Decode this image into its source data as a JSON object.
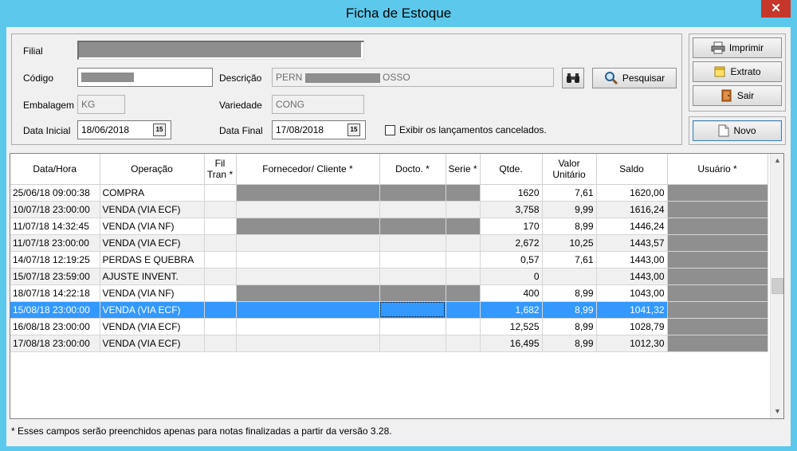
{
  "window": {
    "title": "Ficha de Estoque",
    "close_label": "✕"
  },
  "filters": {
    "filial_label": "Filial",
    "codigo_label": "Código",
    "descricao_label": "Descrição",
    "descricao_prefix": "PERN",
    "descricao_suffix": "OSSO",
    "embalagem_label": "Embalagem",
    "embalagem_value": "KG",
    "variedade_label": "Variedade",
    "variedade_value": "CONG",
    "data_inicial_label": "Data Inicial",
    "data_inicial_value": "18/06/2018",
    "data_final_label": "Data Final",
    "data_final_value": "17/08/2018",
    "cancelados_label": "Exibir os lançamentos cancelados."
  },
  "buttons": {
    "pesquisar": "Pesquisar",
    "imprimir": "Imprimir",
    "extrato": "Extrato",
    "sair": "Sair",
    "novo": "Novo"
  },
  "grid": {
    "columns": [
      "Data/Hora",
      "Operação",
      "Fil Tran *",
      "Fornecedor/ Cliente *",
      "Docto. *",
      "Serie *",
      "Qtde.",
      "Valor Unitário",
      "Saldo",
      "Usuário *"
    ],
    "rows": [
      {
        "data": "25/06/18 09:00:38",
        "op": "COMPRA",
        "qtde": "1620",
        "valor": "7,61",
        "saldo": "1620,00",
        "fc_blur": true
      },
      {
        "data": "10/07/18 23:00:00",
        "op": "VENDA (VIA ECF)",
        "qtde": "3,758",
        "valor": "9,99",
        "saldo": "1616,24",
        "fc_blur": false
      },
      {
        "data": "11/07/18 14:32:45",
        "op": "VENDA (VIA NF)",
        "qtde": "170",
        "valor": "8,99",
        "saldo": "1446,24",
        "fc_blur": true
      },
      {
        "data": "11/07/18 23:00:00",
        "op": "VENDA (VIA ECF)",
        "qtde": "2,672",
        "valor": "10,25",
        "saldo": "1443,57",
        "fc_blur": false
      },
      {
        "data": "14/07/18 12:19:25",
        "op": "PERDAS E QUEBRA",
        "qtde": "0,57",
        "valor": "7,61",
        "saldo": "1443,00",
        "fc_blur": false
      },
      {
        "data": "15/07/18 23:59:00",
        "op": "AJUSTE INVENT.",
        "qtde": "0",
        "valor": "",
        "saldo": "1443,00",
        "fc_blur": false
      },
      {
        "data": "18/07/18 14:22:18",
        "op": "VENDA (VIA NF)",
        "qtde": "400",
        "valor": "8,99",
        "saldo": "1043,00",
        "fc_blur": true
      },
      {
        "data": "15/08/18 23:00:00",
        "op": "VENDA (VIA ECF)",
        "qtde": "1,682",
        "valor": "8,99",
        "saldo": "1041,32",
        "fc_blur": false,
        "selected": true
      },
      {
        "data": "16/08/18 23:00:00",
        "op": "VENDA (VIA ECF)",
        "qtde": "12,525",
        "valor": "8,99",
        "saldo": "1028,79",
        "fc_blur": false
      },
      {
        "data": "17/08/18 23:00:00",
        "op": "VENDA (VIA ECF)",
        "qtde": "16,495",
        "valor": "8,99",
        "saldo": "1012,30",
        "fc_blur": false
      }
    ]
  },
  "footnote": "* Esses campos serão preenchidos apenas para notas finalizadas a partir da versão 3.28.",
  "colors": {
    "selection": "#3399ff",
    "titlebar": "#5cc8ec",
    "close": "#c7362b"
  }
}
